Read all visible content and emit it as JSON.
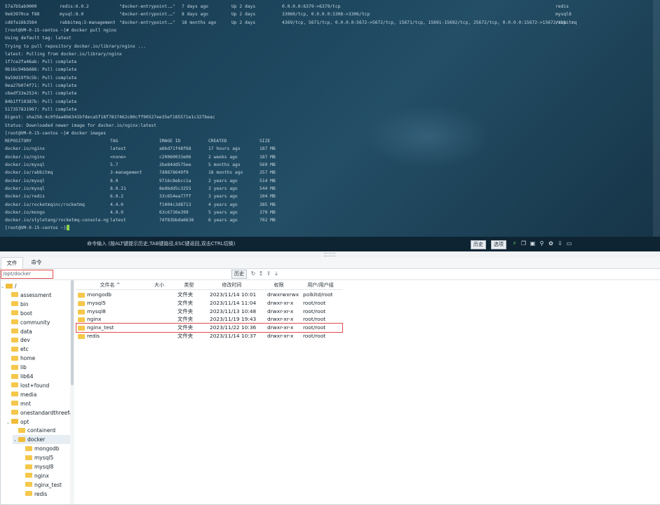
{
  "terminal": {
    "lines": [
      [
        "57a7b5ab9000",
        "redis:6.0.2",
        "\"docker-entrypoint.…\"",
        "7 days ago",
        "Up 2 days",
        "0.0.0.0:6379->6379/tcp",
        "redis"
      ],
      [
        "9e63970ce f88",
        "mysql:8.0",
        "\"docker-entrypoint.…\"",
        "8 days ago",
        "Up 2 days",
        "33060/tcp, 0.0.0.0:3308->3306/tcp",
        "mysql8"
      ],
      [
        "cd6fa16b3584",
        "rabbitmq:3-management",
        "\"docker-entrypoint.…\"",
        "18 months ago",
        "Up 2 days",
        "4369/tcp, 5671/tcp, 0.0.0.0:5672->5672/tcp, 15671/tcp, 15691-15692/tcp, 25672/tcp, 0.0.0.0:15672->15672/tcp",
        "rabbitmq"
      ],
      [
        "[root@VM-0-15-centos ~]# docker pull nginx"
      ],
      [
        "Using default tag: latest"
      ],
      [
        "Trying to pull repository docker.io/library/nginx ..."
      ],
      [
        "latest: Pulling from docker.io/library/nginx"
      ],
      [
        "1f7ce2fa46ab: Pull complete"
      ],
      [
        "9b16c94bb686: Pull complete"
      ],
      [
        "9a59d19f9c5b: Pull complete"
      ],
      [
        "9ea27b074f71: Pull complete"
      ],
      [
        "c6edf33e2524: Pull complete"
      ],
      [
        "84b1ff10387b: Pull complete"
      ],
      [
        "517357831967: Pull complete"
      ],
      [
        "Digest: sha256:4c0fdaa8b6341bfdeca5f18f7837462c80cff90527ee35ef185571e1c327beac"
      ],
      [
        "Status: Downloaded newer image for docker.io/nginx:latest"
      ],
      [
        "[root@VM-0-15-centos ~]# docker images"
      ],
      [
        "REPOSITORY",
        "TAG",
        "IMAGE ID",
        "CREATED",
        "SIZE"
      ],
      [
        "docker.io/nginx",
        "latest",
        "a6bd71f48f68",
        "17 hours ago",
        "187 MB"
      ],
      [
        "docker.io/nginx",
        "<none>",
        "c20060033e06",
        "2 weeks ago",
        "187 MB"
      ],
      [
        "docker.io/mysql",
        "5.7",
        "2be84dd575ee",
        "5 months ago",
        "569 MB"
      ],
      [
        "docker.io/rabbitmq",
        "3-management",
        "7d8878640f9",
        "18 months ago",
        "257 MB"
      ],
      [
        "docker.io/mysql",
        "8.0",
        "9716c8ebcc1a",
        "2 years ago",
        "514 MB"
      ],
      [
        "docker.io/mysql",
        "8.0.21",
        "8e8bdd5c3255",
        "3 years ago",
        "544 MB"
      ],
      [
        "docker.io/redis",
        "6.0.2",
        "33c654ea77ff",
        "3 years ago",
        "104 MB"
      ],
      [
        "docker.io/rocketmqinc/rocketmq",
        "4.4.0",
        "f1004c3d8713",
        "4 years ago",
        "385 MB"
      ],
      [
        "docker.io/mongo",
        "4.0.9",
        "63c6736e399",
        "5 years ago",
        "379 MB"
      ],
      [
        "docker.io/styletang/rocketmq-console-ng",
        "latest",
        "7df83bbda6638",
        "6 years ago",
        "702 MB"
      ],
      [
        "[root@VM-0-15-centos ~]#"
      ]
    ]
  },
  "cmdbar": {
    "hint": "命令输入 (按ALT键提示历史,TAB键路径,ESC键返回,双击CTRL切换)",
    "history_label": "历史",
    "options_label": "选项",
    "icons": [
      "lightning-icon",
      "copy-icon",
      "paste-icon",
      "search-icon",
      "settings-icon",
      "download-icon",
      "maximize-icon"
    ]
  },
  "tabs": {
    "files_label": "文件",
    "command_label": "命令"
  },
  "pathbar": {
    "path": "/opt/docker",
    "history_label": "历史",
    "icons": [
      "refresh-icon",
      "up-icon",
      "upload-icon",
      "download-icon"
    ]
  },
  "tree": {
    "items": [
      {
        "label": "/",
        "depth": 0,
        "expanded": true
      },
      {
        "label": "assessment",
        "depth": 1
      },
      {
        "label": "bin",
        "depth": 1
      },
      {
        "label": "boot",
        "depth": 1
      },
      {
        "label": "community",
        "depth": 1
      },
      {
        "label": "data",
        "depth": 1
      },
      {
        "label": "dev",
        "depth": 1
      },
      {
        "label": "etc",
        "depth": 1
      },
      {
        "label": "home",
        "depth": 1
      },
      {
        "label": "lib",
        "depth": 1
      },
      {
        "label": "lib64",
        "depth": 1
      },
      {
        "label": "lost+found",
        "depth": 1
      },
      {
        "label": "media",
        "depth": 1
      },
      {
        "label": "mnt",
        "depth": 1
      },
      {
        "label": "onestandardthreefact",
        "depth": 1
      },
      {
        "label": "opt",
        "depth": 1,
        "expanded": true
      },
      {
        "label": "containerd",
        "depth": 2
      },
      {
        "label": "docker",
        "depth": 2,
        "expanded": true,
        "selected": true
      },
      {
        "label": "mongodb",
        "depth": 3
      },
      {
        "label": "mysql5",
        "depth": 3
      },
      {
        "label": "mysql8",
        "depth": 3
      },
      {
        "label": "nginx",
        "depth": 3
      },
      {
        "label": "nginx_test",
        "depth": 3
      },
      {
        "label": "redis",
        "depth": 3
      }
    ]
  },
  "grid": {
    "headers": [
      "文件名 ^",
      "大小",
      "类型",
      "修改时间",
      "权限",
      "用户/用户组"
    ],
    "rows": [
      {
        "name": "mongodb",
        "size": "",
        "type": "文件夹",
        "mtime": "2023/11/14 10:01",
        "perm": "drwxrwxrwx",
        "owner": "polkitd/root"
      },
      {
        "name": "mysql5",
        "size": "",
        "type": "文件夹",
        "mtime": "2023/11/14 11:04",
        "perm": "drwxr-xr-x",
        "owner": "root/root"
      },
      {
        "name": "mysql8",
        "size": "",
        "type": "文件夹",
        "mtime": "2023/11/13 10:48",
        "perm": "drwxr-xr-x",
        "owner": "root/root"
      },
      {
        "name": "nginx",
        "size": "",
        "type": "文件夹",
        "mtime": "2023/11/19 19:43",
        "perm": "drwxr-xr-x",
        "owner": "root/root"
      },
      {
        "name": "nginx_test",
        "size": "",
        "type": "文件夹",
        "mtime": "2023/11/22 10:36",
        "perm": "drwxr-xr-x",
        "owner": "root/root",
        "highlighted": true
      },
      {
        "name": "redis",
        "size": "",
        "type": "文件夹",
        "mtime": "2023/11/14 10:37",
        "perm": "drwxr-xr-x",
        "owner": "root/root"
      }
    ]
  },
  "colors": {
    "terminal_bg": "#1f4a62",
    "terminal_text": "#c5d6e1",
    "highlight_border": "#e04a4a",
    "folder": "#f5c74b",
    "prompt_cursor": "#8bd34a"
  }
}
